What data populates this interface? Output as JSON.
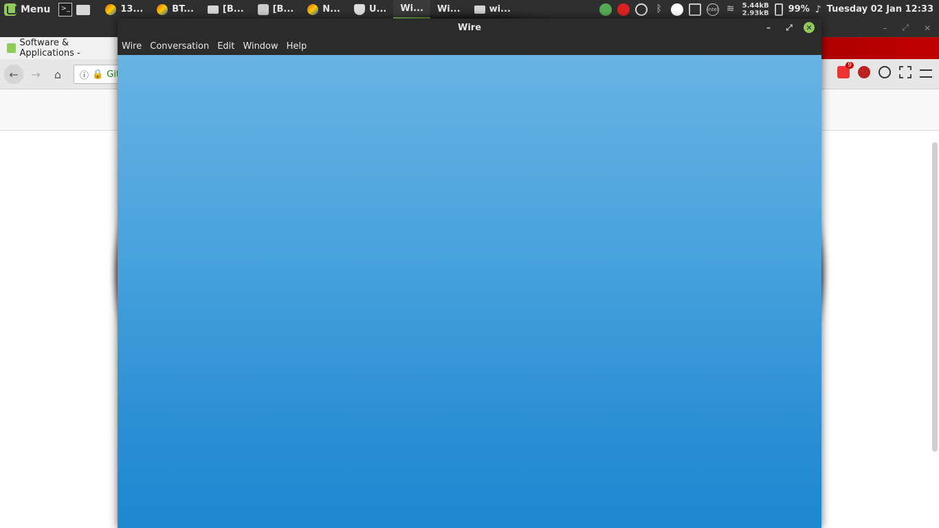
{
  "panel": {
    "menu_label": "Menu",
    "tasks": [
      {
        "label": "13...",
        "icon": "firefox-icon"
      },
      {
        "label": "BT...",
        "icon": "firefox-icon"
      },
      {
        "label": "[B...",
        "icon": "folder-icon"
      },
      {
        "label": "[B...",
        "icon": "video-icon"
      },
      {
        "label": "N...",
        "icon": "firefox-icon"
      },
      {
        "label": "U...",
        "icon": "shield-icon"
      },
      {
        "label": "Wi...",
        "icon": "wire-icon",
        "active": true
      },
      {
        "label": "Wi...",
        "icon": "wire-icon"
      },
      {
        "label": "wi...",
        "icon": "folder-icon"
      }
    ],
    "tray": {
      "net_down": "5.44kB",
      "net_up": "2.93kB",
      "battery": "99%",
      "clock": "Tuesday 02 Jan 12:33"
    }
  },
  "background_window": {
    "tab_title": "Software & Applications -",
    "url_text": "Git",
    "badge_count": "9"
  },
  "wire_window": {
    "title": "Wire",
    "menu": [
      "Wire",
      "Conversation",
      "Edit",
      "Window",
      "Help"
    ],
    "colors": {
      "gradient_top": "#68b3e3",
      "gradient_bottom": "#1e88d1"
    }
  }
}
